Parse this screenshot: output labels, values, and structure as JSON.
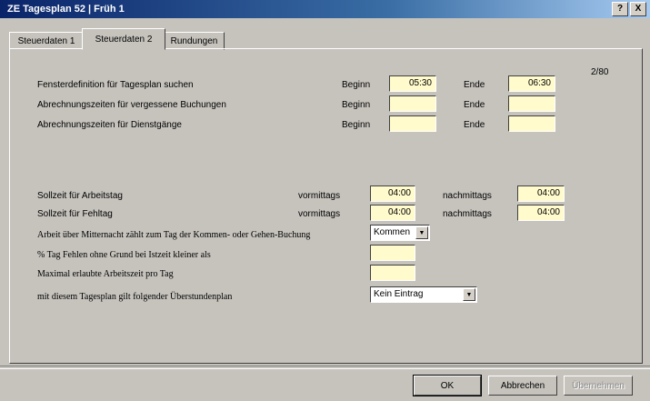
{
  "window": {
    "title": "ZE Tagesplan 52 | Früh 1",
    "help_label": "?",
    "close_label": "X"
  },
  "tabs": [
    "Steuerdaten 1",
    "Steuerdaten 2",
    "Rundungen"
  ],
  "page_counter": "2/80",
  "windows_section": {
    "rows": [
      {
        "label": "Fensterdefinition für Tagesplan suchen",
        "begin_label": "Beginn",
        "begin_value": "05:30",
        "end_label": "Ende",
        "end_value": "06:30"
      },
      {
        "label": "Abrechnungszeiten für vergessene Buchungen",
        "begin_label": "Beginn",
        "begin_value": "",
        "end_label": "Ende",
        "end_value": ""
      },
      {
        "label": "Abrechnungszeiten für Dienstgänge",
        "begin_label": "Beginn",
        "begin_value": "",
        "end_label": "Ende",
        "end_value": ""
      }
    ]
  },
  "target_section": {
    "rows": [
      {
        "label": "Sollzeit für Arbeitstag",
        "am_label": "vormittags",
        "am_value": "04:00",
        "pm_label": "nachmittags",
        "pm_value": "04:00"
      },
      {
        "label": "Sollzeit für Fehltag",
        "am_label": "vormittags",
        "am_value": "04:00",
        "pm_label": "nachmittags",
        "pm_value": "04:00"
      }
    ]
  },
  "options_section": {
    "midnight_label": "Arbeit über Mitternacht zählt zum Tag der Kommen- oder Gehen-Buchung",
    "midnight_value": "Kommen",
    "absence_label": "% Tag Fehlen ohne Grund bei Istzeit kleiner als",
    "absence_value": "",
    "max_label": "Maximal erlaubte Arbeitszeit pro Tag",
    "max_value": "",
    "overtime_label": "mit diesem Tagesplan gilt folgender Überstundenplan",
    "overtime_value": "Kein Eintrag"
  },
  "buttons": {
    "ok": "OK",
    "cancel": "Abbrechen",
    "apply": "Übernehmen"
  }
}
